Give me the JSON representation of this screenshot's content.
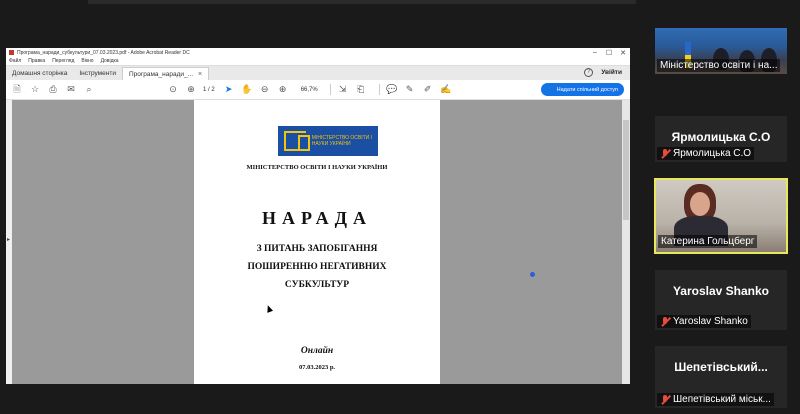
{
  "acrobat": {
    "window_title": "Програма_наради_субкультури_07.03.2023.pdf - Adobe Acrobat Reader DC",
    "menu": [
      "Файл",
      "Правка",
      "Перегляд",
      "Вікно",
      "Довідка"
    ],
    "tabs": {
      "home": "Домашня сторінка",
      "tools": "Інструменти",
      "document": "Програма_наради_..."
    },
    "help_label": "?",
    "signin": "Увійти",
    "page_current": "1",
    "page_total": "/ 2",
    "zoom": "66,7%",
    "share_button": "Надати спільний доступ"
  },
  "document": {
    "logo_text": "МІНІСТЕРСТВО ОСВІТИ І НАУКИ УКРАЇНИ",
    "ministry": "МІНІСТЕРСТВО ОСВІТИ І НАУКИ УКРАЇНИ",
    "title": "НАРАДА",
    "subtitle": "З ПИТАНЬ ЗАПОБІГАННЯ ПОШИРЕННЮ НЕГАТИВНИХ СУБКУЛЬТУР",
    "format": "Онлайн",
    "date": "07.03.2023 р."
  },
  "participants": [
    {
      "big_name": "",
      "label": "Міністерство освіти і на...",
      "muted": false
    },
    {
      "big_name": "Ярмолицька С.О",
      "label": "Ярмолицька С.О",
      "muted": true
    },
    {
      "big_name": "",
      "label": "Катерина Гольцберг",
      "muted": false
    },
    {
      "big_name": "Yaroslav Shanko",
      "label": "Yaroslav Shanko",
      "muted": true
    },
    {
      "big_name": "Шепетівський...",
      "label": "Шепетівський міськ...",
      "muted": true
    }
  ]
}
